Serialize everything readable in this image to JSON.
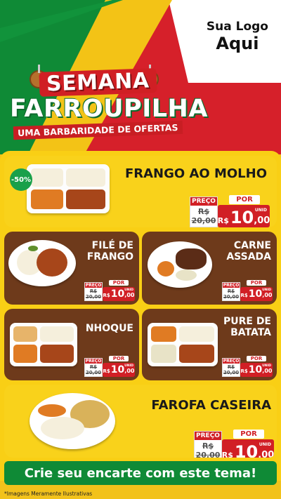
{
  "logo": {
    "line1": "Sua Logo",
    "line2": "Aqui"
  },
  "title": {
    "line1": "SEMANA",
    "line2": "FARROUPILHA",
    "subtitle": "UMA BARBARIDADE DE OFERTAS"
  },
  "discount_badge": "-50%",
  "products": [
    {
      "name_line1": "FRANGO AO MOLHO",
      "name_line2": "",
      "old_label": "PREÇO",
      "old_price": "R$ 20,00",
      "por_label": "POR",
      "currency": "R$",
      "price_int": "10",
      "price_dec": ",00",
      "unit": "UNID"
    },
    {
      "name_line1": "FILÉ DE",
      "name_line2": "FRANGO",
      "old_label": "PREÇO",
      "old_price": "R$ 20,00",
      "por_label": "POR",
      "currency": "R$",
      "price_int": "10",
      "price_dec": ",00",
      "unit": "UNID"
    },
    {
      "name_line1": "CARNE",
      "name_line2": "ASSADA",
      "old_label": "PREÇO",
      "old_price": "R$ 20,00",
      "por_label": "POR",
      "currency": "R$",
      "price_int": "10",
      "price_dec": ",00",
      "unit": "UNID"
    },
    {
      "name_line1": "NHOQUE",
      "name_line2": "",
      "old_label": "PREÇO",
      "old_price": "R$ 20,00",
      "por_label": "POR",
      "currency": "R$",
      "price_int": "10",
      "price_dec": ",00",
      "unit": "UNID"
    },
    {
      "name_line1": "PURE DE",
      "name_line2": "BATATA",
      "old_label": "PREÇO",
      "old_price": "R$ 20,00",
      "por_label": "POR",
      "currency": "R$",
      "price_int": "10",
      "price_dec": ",00",
      "unit": "UNID"
    },
    {
      "name_line1": "FAROFA CASEIRA",
      "name_line2": "",
      "old_label": "PREÇO",
      "old_price": "R$ 20,00",
      "por_label": "POR",
      "currency": "R$",
      "price_int": "10",
      "price_dec": ",00",
      "unit": "UNID"
    }
  ],
  "cta": "Crie seu encarte com este tema!",
  "footer": "*Imagens Meramente Ilustrativas",
  "colors": {
    "green": "#0f8a36",
    "red": "#d11f25",
    "yellow": "#f9d21b",
    "brown": "#6e3a1b"
  }
}
